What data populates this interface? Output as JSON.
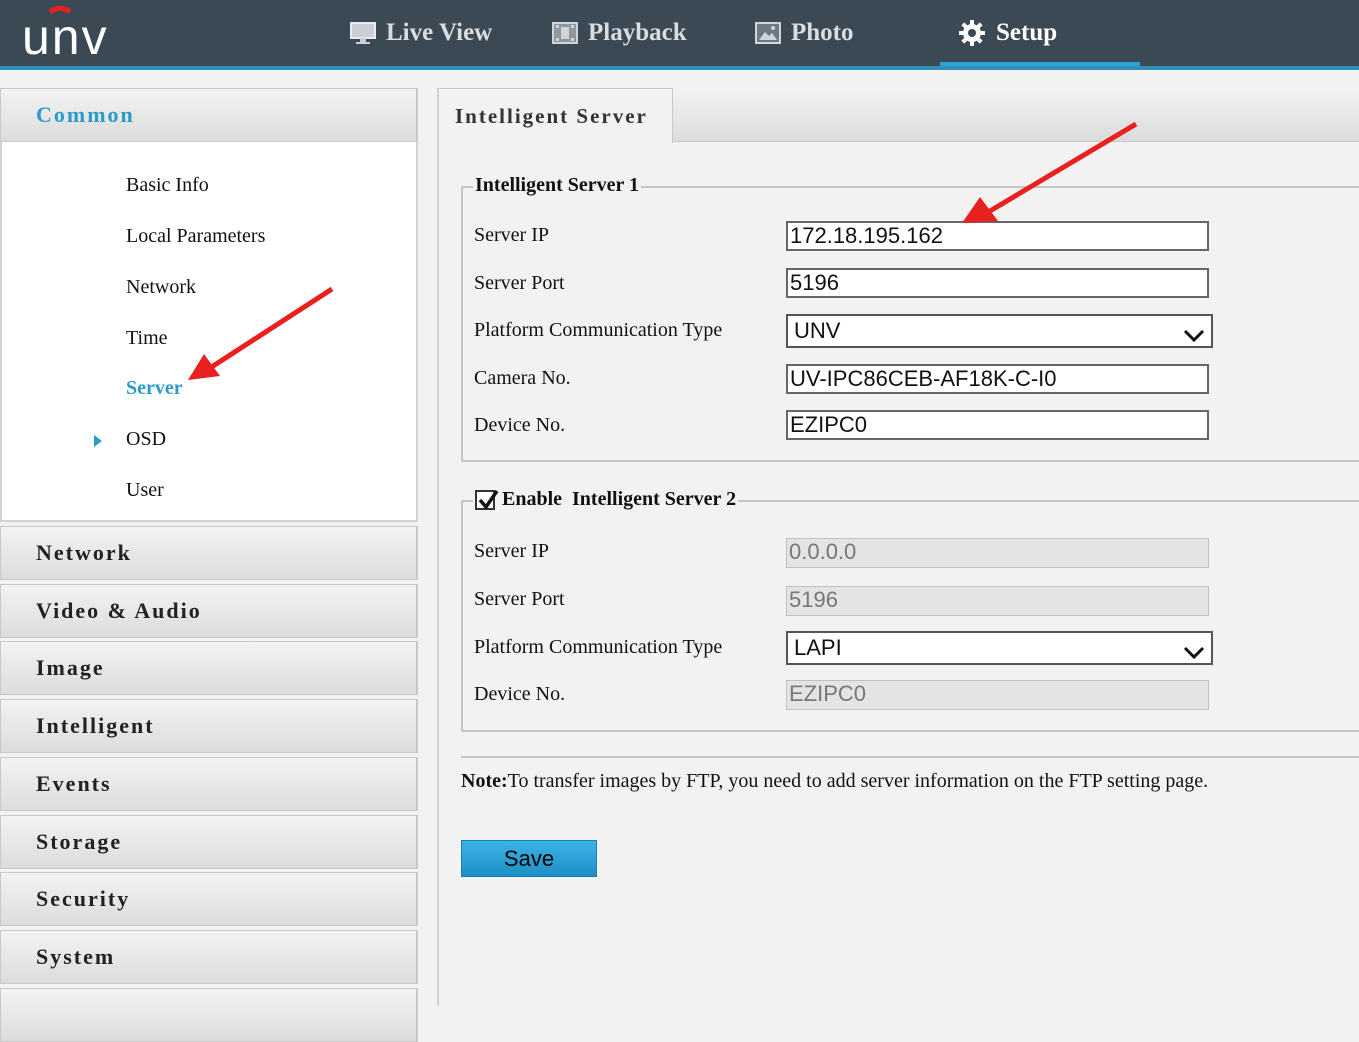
{
  "brand": {
    "logo_text": "unv"
  },
  "nav": {
    "items": [
      {
        "label": "Live View",
        "icon": "monitor-icon"
      },
      {
        "label": "Playback",
        "icon": "film-icon"
      },
      {
        "label": "Photo",
        "icon": "picture-icon"
      },
      {
        "label": "Setup",
        "icon": "gear-icon",
        "active": true
      }
    ]
  },
  "sidebar": {
    "common_label": "Common",
    "common_items": [
      "Basic Info",
      "Local Parameters",
      "Network",
      "Time",
      "Server",
      "OSD",
      "User"
    ],
    "active_item": "Server",
    "sections": [
      "Network",
      "Video & Audio",
      "Image",
      "Intelligent",
      "Events",
      "Storage",
      "Security",
      "System"
    ]
  },
  "main": {
    "tab_label": "Intelligent Server",
    "server1": {
      "legend": "Intelligent Server 1",
      "server_ip_label": "Server IP",
      "server_ip": "172.18.195.162",
      "server_port_label": "Server Port",
      "server_port": "5196",
      "platform_label": "Platform Communication Type",
      "platform": "UNV",
      "camera_no_label": "Camera No.",
      "camera_no": "UV-IPC86CEB-AF18K-C-I0",
      "device_no_label": "Device No.",
      "device_no": "EZIPC0"
    },
    "server2": {
      "legend": "Enable  Intelligent Server 2",
      "enabled": true,
      "server_ip_label": "Server IP",
      "server_ip": "0.0.0.0",
      "server_port_label": "Server Port",
      "server_port": "5196",
      "platform_label": "Platform Communication Type",
      "platform": "LAPI",
      "device_no_label": "Device No.",
      "device_no": "EZIPC0"
    },
    "note_prefix": "Note:",
    "note_text": "To transfer images by FTP, you need to add server information on the FTP setting page.",
    "save_label": "Save"
  },
  "colors": {
    "accent": "#2b9cc9",
    "topbar": "#3a4954",
    "annotation_arrow": "#e8201f"
  }
}
